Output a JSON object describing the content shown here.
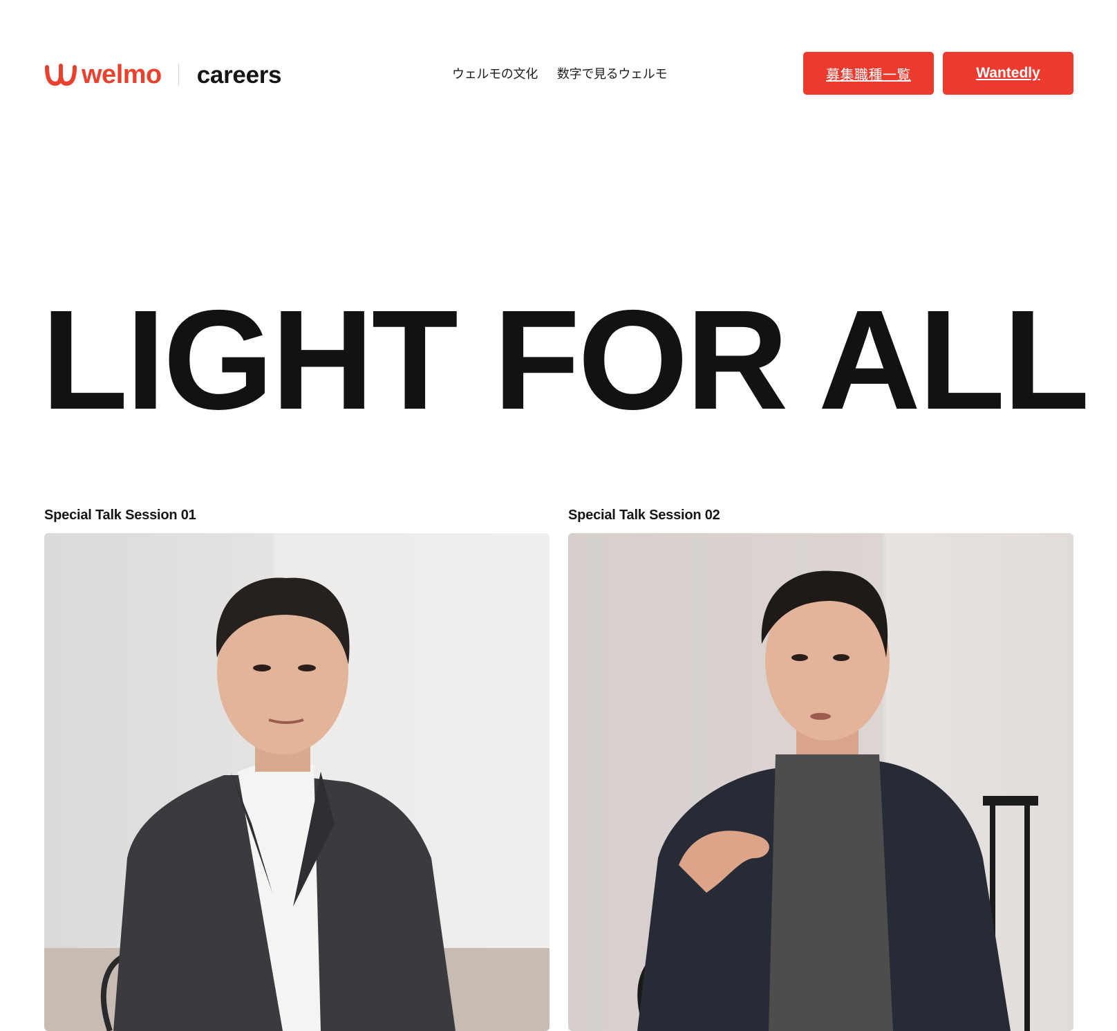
{
  "brand": {
    "name": "welmo",
    "sub": "careers",
    "color": "#e8412e"
  },
  "nav": {
    "items": [
      {
        "label": "ウェルモの文化"
      },
      {
        "label": "数字で見るウェルモ"
      }
    ]
  },
  "header_actions": {
    "jobs_label": "募集職種一覧",
    "wantedly_label": "Wantedly",
    "button_color": "#ec3b2e"
  },
  "hero": {
    "title": "LIGHT FOR ALL"
  },
  "sessions": [
    {
      "label": "Special Talk Session 01"
    },
    {
      "label": "Special Talk Session 02"
    }
  ]
}
